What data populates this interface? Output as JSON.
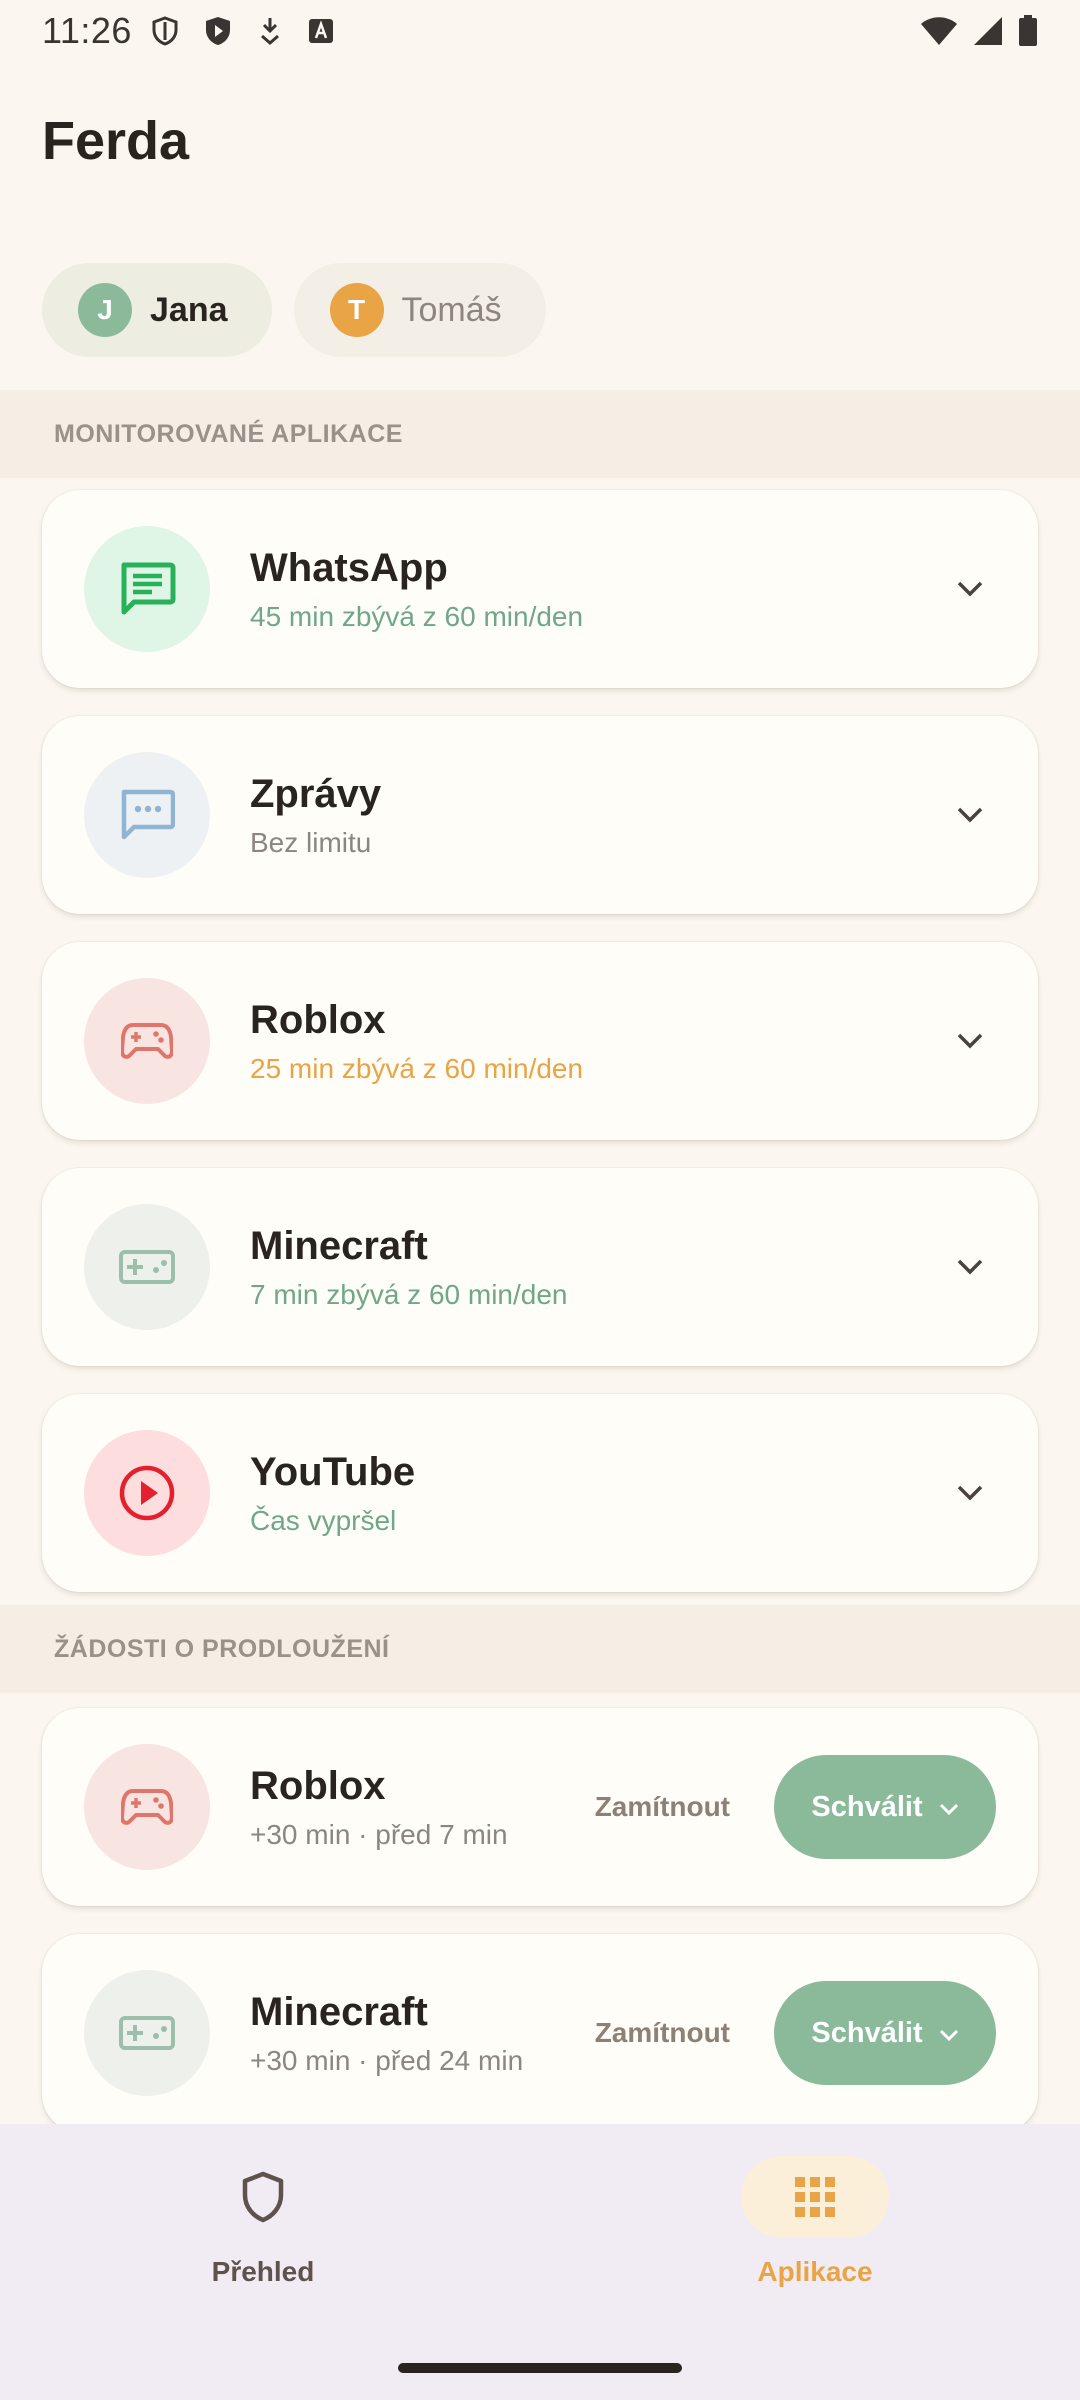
{
  "status_bar": {
    "time": "11:26"
  },
  "header": {
    "title": "Ferda"
  },
  "profiles": [
    {
      "initial": "J",
      "name": "Jana",
      "color": "#8BBA9B",
      "selected": true
    },
    {
      "initial": "T",
      "name": "Tomáš",
      "color": "#E8A445",
      "selected": false
    }
  ],
  "monitored_section": {
    "title": "MONITOROVANÉ APLIKACE",
    "apps": [
      {
        "name": "WhatsApp",
        "status": "45 min zbývá z 60 min/den",
        "status_color": "#6FA788",
        "icon": "chat-icon",
        "icon_bg": "#DFF5E5",
        "icon_color": "#27B25A"
      },
      {
        "name": "Zprávy",
        "status": "Bez limitu",
        "status_color": "#8C8580",
        "icon": "message-dots-icon",
        "icon_bg": "#EEF1F3",
        "icon_color": "#8FB4D4"
      },
      {
        "name": "Roblox",
        "status": "25 min zbývá z 60 min/den",
        "status_color": "#E8A445",
        "icon": "gamepad-icon",
        "icon_bg": "#F8E4E1",
        "icon_color": "#E0766B"
      },
      {
        "name": "Minecraft",
        "status": "7 min zbývá z 60 min/den",
        "status_color": "#6FA788",
        "icon": "game-controller-icon",
        "icon_bg": "#EEF0EC",
        "icon_color": "#9BBFAA"
      },
      {
        "name": "YouTube",
        "status": "Čas vypršel",
        "status_color": "#6FA788",
        "icon": "play-icon",
        "icon_bg": "#FDDDDE",
        "icon_color": "#E3202B"
      }
    ]
  },
  "requests_section": {
    "title": "ŽÁDOSTI O PRODLOUŽENÍ",
    "requests": [
      {
        "name": "Roblox",
        "detail": "+30 min · před 7 min",
        "icon": "gamepad-icon",
        "icon_bg": "#F8E4E1",
        "icon_color": "#E0766B",
        "reject_label": "Zamítnout",
        "approve_label": "Schválit"
      },
      {
        "name": "Minecraft",
        "detail": "+30 min · před 24 min",
        "icon": "game-controller-icon",
        "icon_bg": "#EEF0EC",
        "icon_color": "#9BBFAA",
        "reject_label": "Zamítnout",
        "approve_label": "Schválit"
      }
    ]
  },
  "bottom_nav": {
    "items": [
      {
        "label": "Přehled",
        "icon": "shield-icon",
        "active": false
      },
      {
        "label": "Aplikace",
        "icon": "grid-icon",
        "active": true
      }
    ]
  },
  "colors": {
    "background": "#FBF7F0",
    "accent_green": "#8BBA9B",
    "accent_orange": "#E8A445"
  }
}
